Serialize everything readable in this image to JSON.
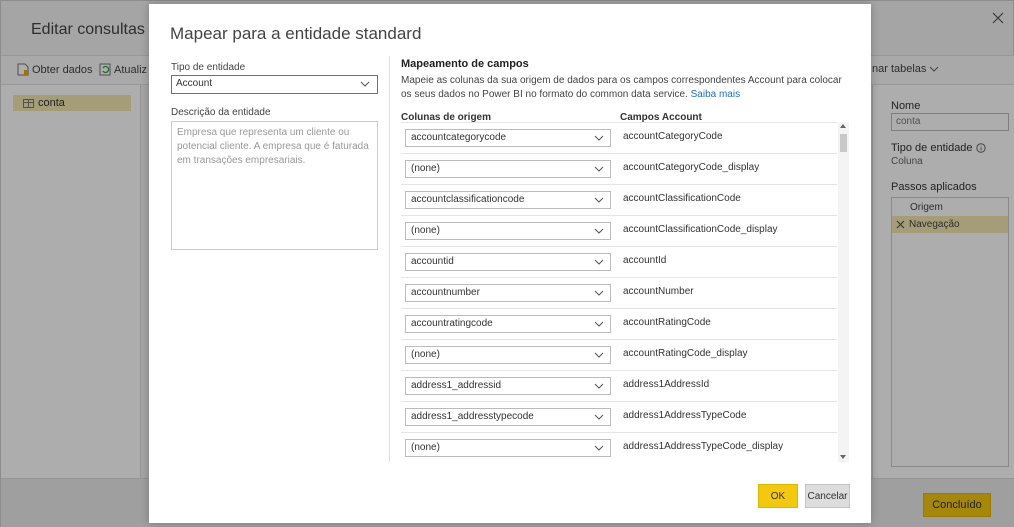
{
  "app": {
    "title": "Editar consultas",
    "toolbar": {
      "get_data": "Obter dados",
      "refresh": "Atualiz",
      "combine": "nar tabelas"
    },
    "queries": [
      {
        "label": "conta"
      }
    ],
    "properties": {
      "name_label": "Nome",
      "name_value": "conta",
      "entity_type_label": "Tipo de entidade",
      "entity_type_value": "Coluna",
      "steps_label": "Passos aplicados",
      "steps": [
        {
          "label": "Origem"
        },
        {
          "label": "Navegação"
        }
      ]
    },
    "done_button": "Concluído"
  },
  "dialog": {
    "title": "Mapear para a entidade standard",
    "entity_type_label": "Tipo de entidade",
    "entity_type_value": "Account",
    "description_label": "Descrição da entidade",
    "description_text": "Empresa que representa um cliente ou potencial cliente. A empresa que é faturada em transações empresariais.",
    "mapping_title": "Mapeamento de campos",
    "mapping_description": "Mapeie as colunas da sua origem de dados para os campos correspondentes Account para colocar os seus dados no Power BI no formato do common data service.",
    "learn_more": "Saiba mais",
    "col_source": "Colunas de origem",
    "col_target": "Campos Account",
    "rows": [
      {
        "source": "accountcategorycode",
        "field": "accountCategoryCode"
      },
      {
        "source": "(none)",
        "field": "accountCategoryCode_display"
      },
      {
        "source": "accountclassificationcode",
        "field": "accountClassificationCode"
      },
      {
        "source": "(none)",
        "field": "accountClassificationCode_display"
      },
      {
        "source": "accountid",
        "field": "accountId"
      },
      {
        "source": "accountnumber",
        "field": "accountNumber"
      },
      {
        "source": "accountratingcode",
        "field": "accountRatingCode"
      },
      {
        "source": "(none)",
        "field": "accountRatingCode_display"
      },
      {
        "source": "address1_addressid",
        "field": "address1AddressId"
      },
      {
        "source": "address1_addresstypecode",
        "field": "address1AddressTypeCode"
      },
      {
        "source": "(none)",
        "field": "address1AddressTypeCode_display"
      }
    ],
    "ok_label": "OK",
    "cancel_label": "Cancelar"
  },
  "colors": {
    "accent": "#f2c811",
    "link": "#1f6fc5",
    "selection": "#f2e8b0"
  }
}
